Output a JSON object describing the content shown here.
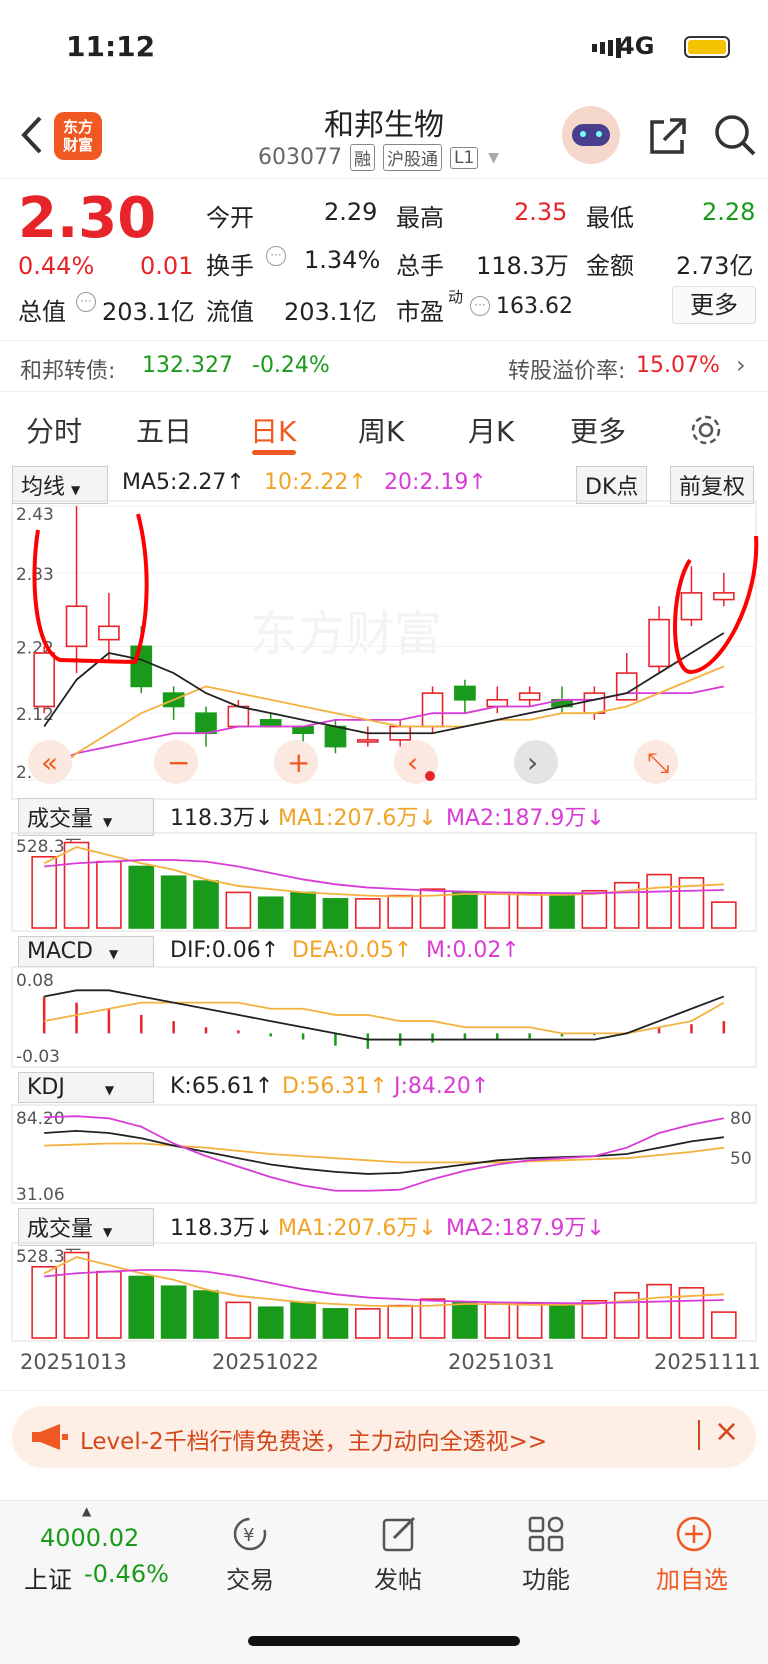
{
  "status_bar": {
    "time": "11:12",
    "network": "4G"
  },
  "header": {
    "logo_line1": "东方",
    "logo_line2": "财富",
    "stock_name": "和邦生物",
    "stock_code": "603077",
    "tags": [
      "融",
      "沪股通",
      "L1"
    ]
  },
  "quote": {
    "price": "2.30",
    "change_pct": "0.44%",
    "change": "0.01",
    "open_label": "今开",
    "open": "2.29",
    "high_label": "最高",
    "high": "2.35",
    "low_label": "最低",
    "low": "2.28",
    "turnover_label": "换手",
    "turnover": "1.34%",
    "volume_label": "总手",
    "volume": "118.3万",
    "amount_label": "金额",
    "amount": "2.73亿",
    "mktcap_label": "总值",
    "mktcap": "203.1亿",
    "float_label": "流值",
    "float": "203.1亿",
    "pe_label": "市盈",
    "pe_sup": "动",
    "pe": "163.62",
    "more_button": "更多"
  },
  "convertible": {
    "label": "和邦转债:",
    "price": "132.327",
    "change": "-0.24%",
    "premium_label": "转股溢价率:",
    "premium": "15.07%"
  },
  "tabs": [
    "分时",
    "五日",
    "日K",
    "周K",
    "月K",
    "更多"
  ],
  "chart_controls": {
    "ma_select": "均线",
    "ma5": "MA5:2.27↑",
    "ma10": "10:2.22↑",
    "ma20": "20:2.19↑",
    "dk_button": "DK点",
    "adjust_button": "前复权"
  },
  "indicators": {
    "vol_select": "成交量",
    "vol_value": "118.3万↓",
    "vol_ma1": "MA1:207.6万↓",
    "vol_ma2": "MA2:187.9万↓",
    "vol_max": "528.3万",
    "macd_select": "MACD",
    "dif": "DIF:0.06↑",
    "dea": "DEA:0.05↑",
    "m": "M:0.02↑",
    "macd_top": "0.08",
    "macd_bottom": "-0.03",
    "kdj_select": "KDJ",
    "k": "K:65.61↑",
    "d": "D:56.31↑",
    "j": "J:84.20↑",
    "kdj_top": "84.20",
    "kdj_bottom": "31.06",
    "kdj_80": "80",
    "kdj_50": "50",
    "vol2_select": "成交量",
    "vol2_value": "118.3万↓",
    "vol2_ma1": "MA1:207.6万↓",
    "vol2_ma2": "MA2:187.9万↓",
    "vol2_max": "528.3万"
  },
  "dates": [
    "20251013",
    "20251022",
    "20251031",
    "20251111"
  ],
  "banner": {
    "text": "Level-2千档行情免费送，主力动向全透视>>"
  },
  "bottom_nav": {
    "index_value": "4000.02",
    "index_name": "上证",
    "index_change": "-0.46%",
    "items": [
      "交易",
      "发帖",
      "功能",
      "加自选"
    ]
  },
  "chart_data": {
    "type": "candlestick",
    "y_ticks": [
      "2.43",
      "2.33",
      "2.22",
      "2.12",
      "2.02"
    ],
    "ylim": [
      2.02,
      2.43
    ],
    "candles": [
      {
        "o": 2.13,
        "c": 2.21,
        "h": 2.22,
        "l": 2.12
      },
      {
        "o": 2.22,
        "c": 2.28,
        "h": 2.43,
        "l": 2.18
      },
      {
        "o": 2.23,
        "c": 2.25,
        "h": 2.3,
        "l": 2.2
      },
      {
        "o": 2.22,
        "c": 2.16,
        "h": 2.25,
        "l": 2.15
      },
      {
        "o": 2.15,
        "c": 2.13,
        "h": 2.16,
        "l": 2.11
      },
      {
        "o": 2.12,
        "c": 2.09,
        "h": 2.13,
        "l": 2.07
      },
      {
        "o": 2.1,
        "c": 2.13,
        "h": 2.14,
        "l": 2.1
      },
      {
        "o": 2.11,
        "c": 2.1,
        "h": 2.12,
        "l": 2.1
      },
      {
        "o": 2.1,
        "c": 2.09,
        "h": 2.1,
        "l": 2.06
      },
      {
        "o": 2.1,
        "c": 2.07,
        "h": 2.11,
        "l": 2.06
      },
      {
        "o": 2.08,
        "c": 2.08,
        "h": 2.1,
        "l": 2.07
      },
      {
        "o": 2.08,
        "c": 2.1,
        "h": 2.11,
        "l": 2.07
      },
      {
        "o": 2.1,
        "c": 2.15,
        "h": 2.16,
        "l": 2.09
      },
      {
        "o": 2.16,
        "c": 2.14,
        "h": 2.17,
        "l": 2.12
      },
      {
        "o": 2.13,
        "c": 2.14,
        "h": 2.16,
        "l": 2.12
      },
      {
        "o": 2.14,
        "c": 2.15,
        "h": 2.16,
        "l": 2.13
      },
      {
        "o": 2.14,
        "c": 2.13,
        "h": 2.16,
        "l": 2.12
      },
      {
        "o": 2.12,
        "c": 2.15,
        "h": 2.16,
        "l": 2.11
      },
      {
        "o": 2.14,
        "c": 2.18,
        "h": 2.21,
        "l": 2.14
      },
      {
        "o": 2.19,
        "c": 2.26,
        "h": 2.28,
        "l": 2.18
      },
      {
        "o": 2.26,
        "c": 2.3,
        "h": 2.34,
        "l": 2.25
      },
      {
        "o": 2.29,
        "c": 2.3,
        "h": 2.33,
        "l": 2.28
      }
    ],
    "ma5": [
      2.1,
      2.17,
      2.21,
      2.2,
      2.18,
      2.15,
      2.13,
      2.12,
      2.11,
      2.1,
      2.09,
      2.09,
      2.09,
      2.1,
      2.11,
      2.12,
      2.13,
      2.14,
      2.15,
      2.18,
      2.21,
      2.24
    ],
    "ma10": [
      2.02,
      2.06,
      2.09,
      2.12,
      2.14,
      2.16,
      2.15,
      2.14,
      2.13,
      2.12,
      2.11,
      2.1,
      2.1,
      2.1,
      2.11,
      2.11,
      2.12,
      2.12,
      2.13,
      2.15,
      2.17,
      2.19
    ],
    "ma20": [
      2.04,
      2.06,
      2.07,
      2.08,
      2.09,
      2.09,
      2.1,
      2.1,
      2.1,
      2.11,
      2.11,
      2.11,
      2.12,
      2.12,
      2.13,
      2.13,
      2.14,
      2.14,
      2.15,
      2.15,
      2.15,
      2.16
    ],
    "volume": [
      440,
      528,
      410,
      380,
      320,
      290,
      220,
      190,
      220,
      180,
      180,
      200,
      240,
      220,
      210,
      210,
      200,
      230,
      280,
      330,
      310,
      160
    ],
    "vol_ma1": [
      400,
      500,
      450,
      400,
      360,
      300,
      260,
      240,
      220,
      210,
      200,
      195,
      200,
      210,
      210,
      205,
      205,
      210,
      230,
      250,
      260,
      270
    ],
    "vol_ma2": [
      380,
      400,
      410,
      420,
      420,
      410,
      380,
      340,
      300,
      270,
      250,
      240,
      230,
      225,
      220,
      218,
      215,
      215,
      220,
      225,
      230,
      235
    ],
    "macd_dif": [
      0.06,
      0.07,
      0.07,
      0.06,
      0.05,
      0.04,
      0.03,
      0.02,
      0.01,
      0.0,
      -0.01,
      -0.01,
      -0.01,
      -0.01,
      -0.01,
      -0.01,
      -0.01,
      -0.01,
      0.0,
      0.02,
      0.04,
      0.06
    ],
    "macd_dea": [
      0.02,
      0.03,
      0.04,
      0.05,
      0.05,
      0.05,
      0.05,
      0.04,
      0.04,
      0.03,
      0.03,
      0.02,
      0.02,
      0.01,
      0.01,
      0.01,
      0.0,
      0.0,
      0.0,
      0.01,
      0.02,
      0.05
    ],
    "macd_hist": [
      0.06,
      0.05,
      0.04,
      0.03,
      0.02,
      0.01,
      0.005,
      -0.005,
      -0.01,
      -0.02,
      -0.025,
      -0.02,
      -0.015,
      -0.01,
      -0.01,
      -0.008,
      -0.005,
      -0.003,
      0.002,
      0.01,
      0.015,
      0.02
    ],
    "kdj_k": [
      70,
      72,
      70,
      65,
      58,
      52,
      46,
      40,
      36,
      33,
      31,
      32,
      36,
      40,
      44,
      46,
      47,
      48,
      50,
      56,
      62,
      66
    ],
    "kdj_d": [
      58,
      59,
      60,
      60,
      58,
      56,
      53,
      50,
      48,
      46,
      44,
      42,
      42,
      42,
      42,
      43,
      44,
      45,
      46,
      49,
      52,
      56
    ],
    "kdj_j": [
      85,
      86,
      84,
      76,
      60,
      48,
      38,
      28,
      20,
      15,
      15,
      16,
      26,
      34,
      40,
      44,
      46,
      48,
      56,
      70,
      78,
      84
    ]
  }
}
